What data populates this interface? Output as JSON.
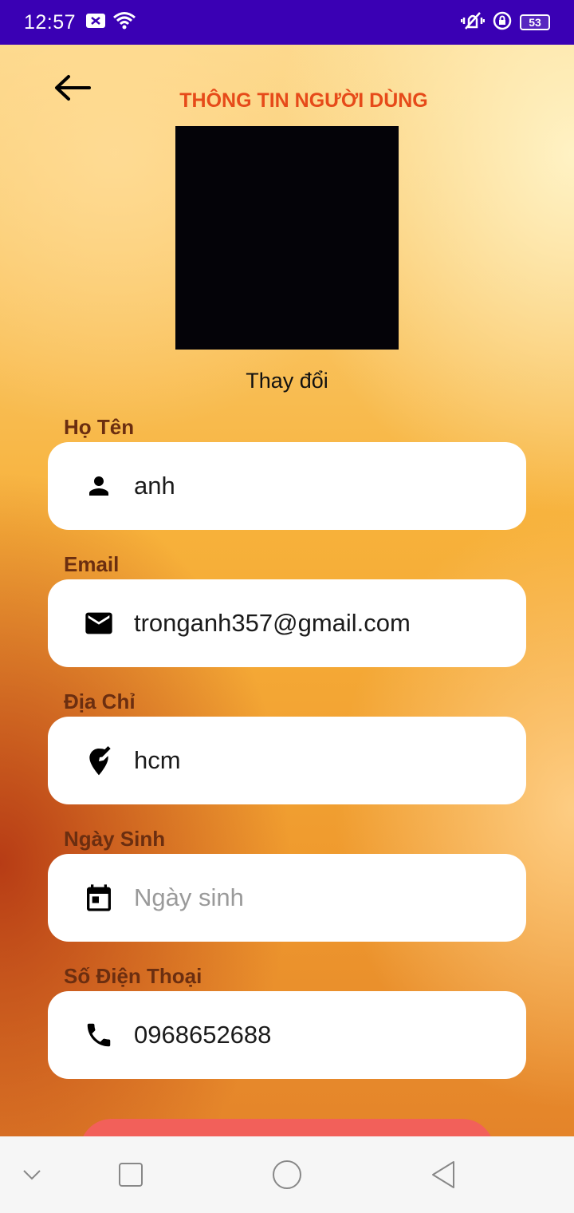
{
  "status_bar": {
    "time": "12:57",
    "battery": "53"
  },
  "header": {
    "title": "THÔNG TIN NGƯỜI DÙNG"
  },
  "avatar": {
    "change_label": "Thay đổi"
  },
  "fields": [
    {
      "label": "Họ Tên",
      "value": "anh",
      "placeholder": "",
      "icon": "person-icon"
    },
    {
      "label": "Email",
      "value": "tronganh357@gmail.com",
      "placeholder": "",
      "icon": "mail-icon"
    },
    {
      "label": "Địa Chỉ",
      "value": "hcm",
      "placeholder": "",
      "icon": "edit-location-icon"
    },
    {
      "label": "Ngày Sinh",
      "value": "",
      "placeholder": "Ngày sinh",
      "icon": "calendar-icon"
    },
    {
      "label": "Số Điện Thoại",
      "value": "0968652688",
      "placeholder": "",
      "icon": "phone-icon"
    }
  ],
  "colors": {
    "status_bar": "#3a00b4",
    "title": "#e64a19",
    "label": "#6b2e10",
    "submit_button": "#f2605a"
  }
}
